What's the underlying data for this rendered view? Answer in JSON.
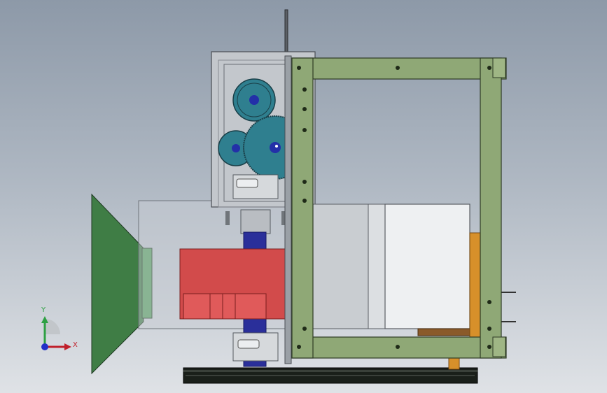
{
  "viewport": {
    "background_top": "#8d99a8",
    "background_bottom": "#dfe2e6"
  },
  "colors": {
    "frame": "#8fa876",
    "frame_edge": "#2d3a24",
    "gear": "#2f7f8f",
    "gear_hub": "#2330a8",
    "motor": "#d24b4b",
    "hopper": "#3f7d45",
    "shaft": "#2a2f9a",
    "housing": "#c8ccd0",
    "box": "#eef0f2",
    "bracket": "#d7902a"
  },
  "triad": {
    "y_label": "Y",
    "x_label": "X",
    "y_color": "#2ea043",
    "x_color": "#c0202b",
    "z_color": "#2330c8"
  }
}
